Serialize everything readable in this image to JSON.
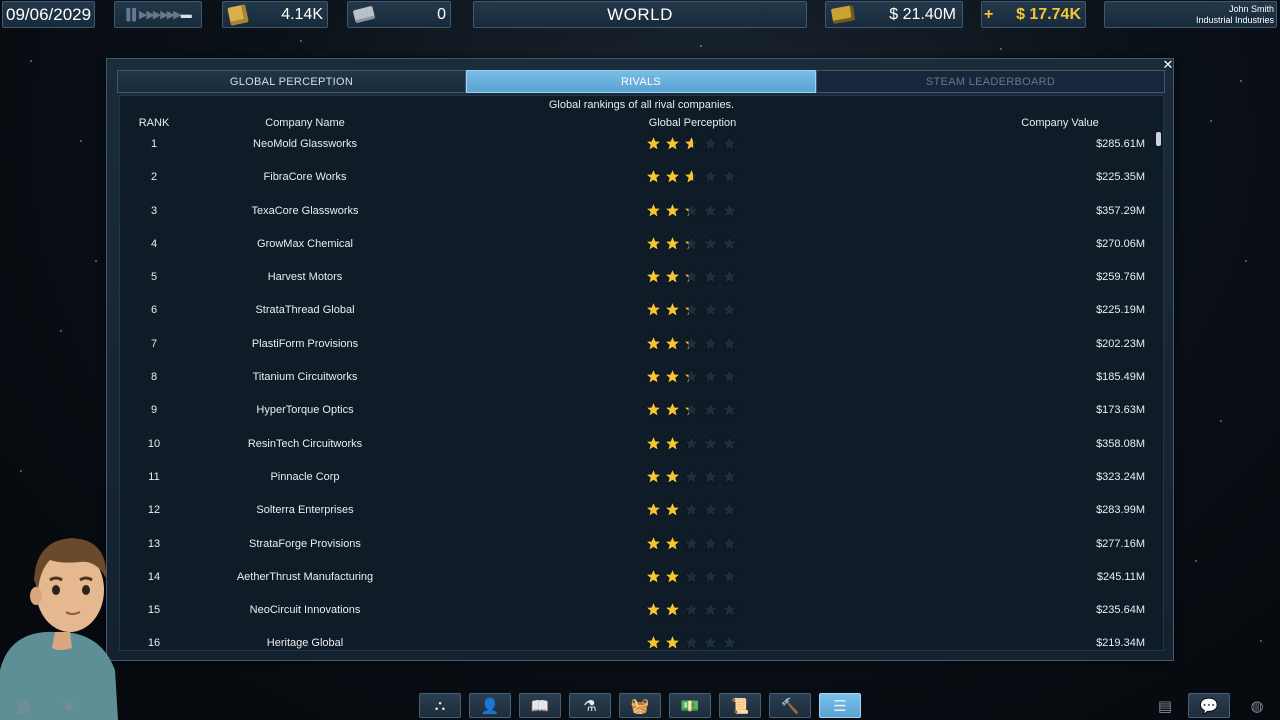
{
  "topbar": {
    "date": "09/06/2029",
    "resource1_value": "4.14K",
    "resource2_value": "0",
    "view_title": "WORLD",
    "money": "$ 21.40M",
    "income_sign": "+",
    "income": "$ 17.74K",
    "user_name": "John Smith",
    "company_name": "Industrial Industries"
  },
  "panel": {
    "tabs": [
      {
        "label": "GLOBAL PERCEPTION",
        "active": false
      },
      {
        "label": "RIVALS",
        "active": true
      },
      {
        "label": "STEAM LEADERBOARD",
        "active": false
      }
    ],
    "subtitle": "Global rankings of all rival companies.",
    "headers": {
      "rank": "RANK",
      "name": "Company Name",
      "perception": "Global Perception",
      "value": "Company Value"
    },
    "rows": [
      {
        "rank": "1",
        "name": "NeoMold Glassworks",
        "stars": 2.6,
        "value": "$285.61M"
      },
      {
        "rank": "2",
        "name": "FibraCore Works",
        "stars": 2.6,
        "value": "$225.35M"
      },
      {
        "rank": "3",
        "name": "TexaCore Glassworks",
        "stars": 2.3,
        "value": "$357.29M"
      },
      {
        "rank": "4",
        "name": "GrowMax Chemical",
        "stars": 2.3,
        "value": "$270.06M"
      },
      {
        "rank": "5",
        "name": "Harvest Motors",
        "stars": 2.3,
        "value": "$259.76M"
      },
      {
        "rank": "6",
        "name": "StrataThread Global",
        "stars": 2.3,
        "value": "$225.19M"
      },
      {
        "rank": "7",
        "name": "PlastiForm Provisions",
        "stars": 2.3,
        "value": "$202.23M"
      },
      {
        "rank": "8",
        "name": "Titanium Circuitworks",
        "stars": 2.3,
        "value": "$185.49M"
      },
      {
        "rank": "9",
        "name": "HyperTorque Optics",
        "stars": 2.3,
        "value": "$173.63M"
      },
      {
        "rank": "10",
        "name": "ResinTech Circuitworks",
        "stars": 2.0,
        "value": "$358.08M"
      },
      {
        "rank": "11",
        "name": "Pinnacle Corp",
        "stars": 2.0,
        "value": "$323.24M"
      },
      {
        "rank": "12",
        "name": "Solterra Enterprises",
        "stars": 2.0,
        "value": "$283.99M"
      },
      {
        "rank": "13",
        "name": "StrataForge Provisions",
        "stars": 2.0,
        "value": "$277.16M"
      },
      {
        "rank": "14",
        "name": "AetherThrust Manufacturing",
        "stars": 2.0,
        "value": "$245.11M"
      },
      {
        "rank": "15",
        "name": "NeoCircuit Innovations",
        "stars": 2.0,
        "value": "$235.64M"
      },
      {
        "rank": "16",
        "name": "Heritage Global",
        "stars": 2.0,
        "value": "$219.34M"
      }
    ],
    "max_stars": 5
  },
  "colors": {
    "star_gold": "#f4c632",
    "star_empty": "#1f2e3c",
    "accent_blue": "#5aa3d4",
    "income_yellow": "#f4c632"
  },
  "bottombar": {
    "left_icons": [
      "buildings-icon",
      "plant-icon"
    ],
    "center_icons": [
      "org-chart-icon",
      "add-user-icon",
      "book-icon",
      "flask-icon",
      "basket-icon",
      "money-icon",
      "scroll-icon",
      "hammer-icon",
      "list-icon"
    ],
    "active_icon": "list-icon",
    "right_icons": [
      "server-icon",
      "chat-icon",
      "globe-icon"
    ]
  }
}
